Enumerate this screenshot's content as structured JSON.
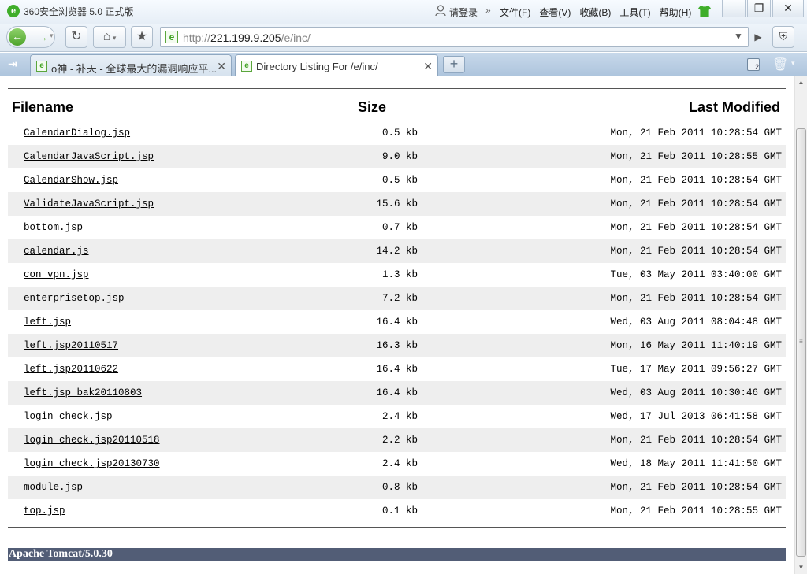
{
  "window": {
    "title": "360安全浏览器 5.0 正式版",
    "login_label": "请登录",
    "menu": [
      "文件(F)",
      "查看(V)",
      "收藏(B)",
      "工具(T)",
      "帮助(H)"
    ]
  },
  "address": {
    "scheme": "http://",
    "host": "221.199.9.205",
    "path": "/e/inc/"
  },
  "tabs": [
    {
      "label": "o神 - 补天 - 全球最大的漏洞响应平..."
    },
    {
      "label": "Directory Listing For /e/inc/"
    }
  ],
  "tab_restore_count": "2",
  "listing": {
    "headers": {
      "name": "Filename",
      "size": "Size",
      "modified": "Last Modified"
    },
    "files": [
      {
        "name": "CalendarDialog.jsp",
        "size": "0.5 kb",
        "modified": "Mon, 21 Feb 2011 10:28:54 GMT"
      },
      {
        "name": "CalendarJavaScript.jsp",
        "size": "9.0 kb",
        "modified": "Mon, 21 Feb 2011 10:28:55 GMT"
      },
      {
        "name": "CalendarShow.jsp",
        "size": "0.5 kb",
        "modified": "Mon, 21 Feb 2011 10:28:54 GMT"
      },
      {
        "name": "ValidateJavaScript.jsp",
        "size": "15.6 kb",
        "modified": "Mon, 21 Feb 2011 10:28:54 GMT"
      },
      {
        "name": "bottom.jsp",
        "size": "0.7 kb",
        "modified": "Mon, 21 Feb 2011 10:28:54 GMT"
      },
      {
        "name": "calendar.js",
        "size": "14.2 kb",
        "modified": "Mon, 21 Feb 2011 10:28:54 GMT"
      },
      {
        "name": "con_vpn.jsp",
        "size": "1.3 kb",
        "modified": "Tue, 03 May 2011 03:40:00 GMT"
      },
      {
        "name": "enterprisetop.jsp",
        "size": "7.2 kb",
        "modified": "Mon, 21 Feb 2011 10:28:54 GMT"
      },
      {
        "name": "left.jsp",
        "size": "16.4 kb",
        "modified": "Wed, 03 Aug 2011 08:04:48 GMT"
      },
      {
        "name": "left.jsp20110517",
        "size": "16.3 kb",
        "modified": "Mon, 16 May 2011 11:40:19 GMT"
      },
      {
        "name": "left.jsp20110622",
        "size": "16.4 kb",
        "modified": "Tue, 17 May 2011 09:56:27 GMT"
      },
      {
        "name": "left.jsp_bak20110803",
        "size": "16.4 kb",
        "modified": "Wed, 03 Aug 2011 10:30:46 GMT"
      },
      {
        "name": "login_check.jsp",
        "size": "2.4 kb",
        "modified": "Wed, 17 Jul 2013 06:41:58 GMT"
      },
      {
        "name": "login_check.jsp20110518",
        "size": "2.2 kb",
        "modified": "Mon, 21 Feb 2011 10:28:54 GMT"
      },
      {
        "name": "login_check.jsp20130730",
        "size": "2.4 kb",
        "modified": "Wed, 18 May 2011 11:41:50 GMT"
      },
      {
        "name": "module.jsp",
        "size": "0.8 kb",
        "modified": "Mon, 21 Feb 2011 10:28:54 GMT"
      },
      {
        "name": "top.jsp",
        "size": "0.1 kb",
        "modified": "Mon, 21 Feb 2011 10:28:55 GMT"
      }
    ]
  },
  "footer": {
    "server": "Apache Tomcat/5.0.30"
  },
  "icons": {
    "app_logo": "360-browser-logo-icon",
    "login": "user-icon",
    "skin": "tshirt-skin-icon",
    "back": "back-arrow-icon",
    "forward": "forward-arrow-icon",
    "refresh": "refresh-icon",
    "home": "home-icon",
    "favorite": "star-icon",
    "page": "ie-page-icon",
    "shield": "shield-icon",
    "trash": "trash-icon"
  },
  "colors": {
    "footer_bar": "#525d76",
    "row_alt": "#eeeeee",
    "brand_green": "#3fae2a"
  }
}
